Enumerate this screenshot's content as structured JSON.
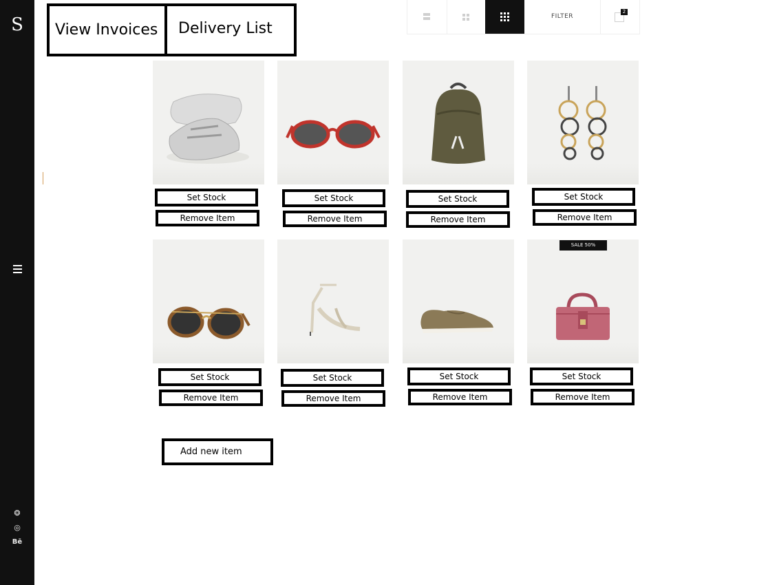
{
  "sidebar": {
    "logo": "S",
    "social": [
      "dribbble-icon",
      "instagram-icon",
      "behance-icon"
    ],
    "behance_label": "Bē"
  },
  "nav": {
    "invoices_label": "View Invoices",
    "delivery_label": "Delivery List"
  },
  "toolbar": {
    "filter_label": "FILTER",
    "cart_count": "2"
  },
  "products": [
    {
      "image": "sneakers",
      "set_stock": "Set Stock",
      "remove": "Remove Item"
    },
    {
      "image": "red-sunglasses",
      "set_stock": "Set Stock",
      "remove": "Remove Item"
    },
    {
      "image": "green-backpack",
      "set_stock": "Set Stock",
      "remove": "Remove Item"
    },
    {
      "image": "ring-earrings",
      "set_stock": "Set Stock",
      "remove": "Remove Item"
    },
    {
      "image": "tortoise-sunglasses",
      "set_stock": "Set Stock",
      "remove": "Remove Item"
    },
    {
      "image": "strappy-heel",
      "set_stock": "Set Stock",
      "remove": "Remove Item"
    },
    {
      "image": "khaki-derby-shoe",
      "set_stock": "Set Stock",
      "remove": "Remove Item"
    },
    {
      "image": "pink-handbag",
      "badge": "SALE 50%",
      "set_stock": "Set Stock",
      "remove": "Remove Item"
    }
  ],
  "add_item_label": "Add new item",
  "colors": {
    "sidebar": "#111111",
    "active_toolbar": "#111111",
    "card_bg": "#f1f1ef"
  }
}
